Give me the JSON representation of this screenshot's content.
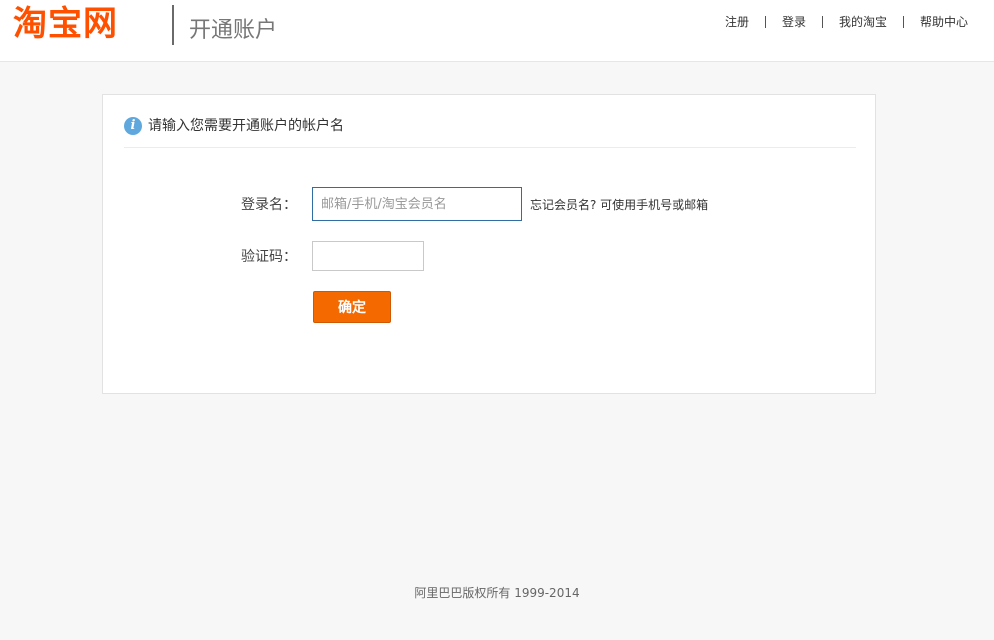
{
  "header": {
    "logo_text": "淘宝网",
    "page_name": "开通账户",
    "nav": [
      {
        "label": "注册"
      },
      {
        "label": "登录"
      },
      {
        "label": "我的淘宝"
      },
      {
        "label": "帮助中心"
      }
    ]
  },
  "card": {
    "info_icon": "info-icon",
    "info_glyph": "i",
    "title": "请输入您需要开通账户的帐户名",
    "login": {
      "label": "登录名：",
      "placeholder": "邮箱/手机/淘宝会员名",
      "value": "",
      "hint": "忘记会员名? 可使用手机号或邮箱"
    },
    "captcha": {
      "label": "验证码：",
      "value": ""
    },
    "submit_label": "确定"
  },
  "footer": {
    "copyright": "阿里巴巴版权所有 1999-2014"
  },
  "colors": {
    "brand": "#ff5000",
    "button": "#f56a00",
    "info_icon": "#5fa8de",
    "input_focus_border": "#2f6da3"
  }
}
